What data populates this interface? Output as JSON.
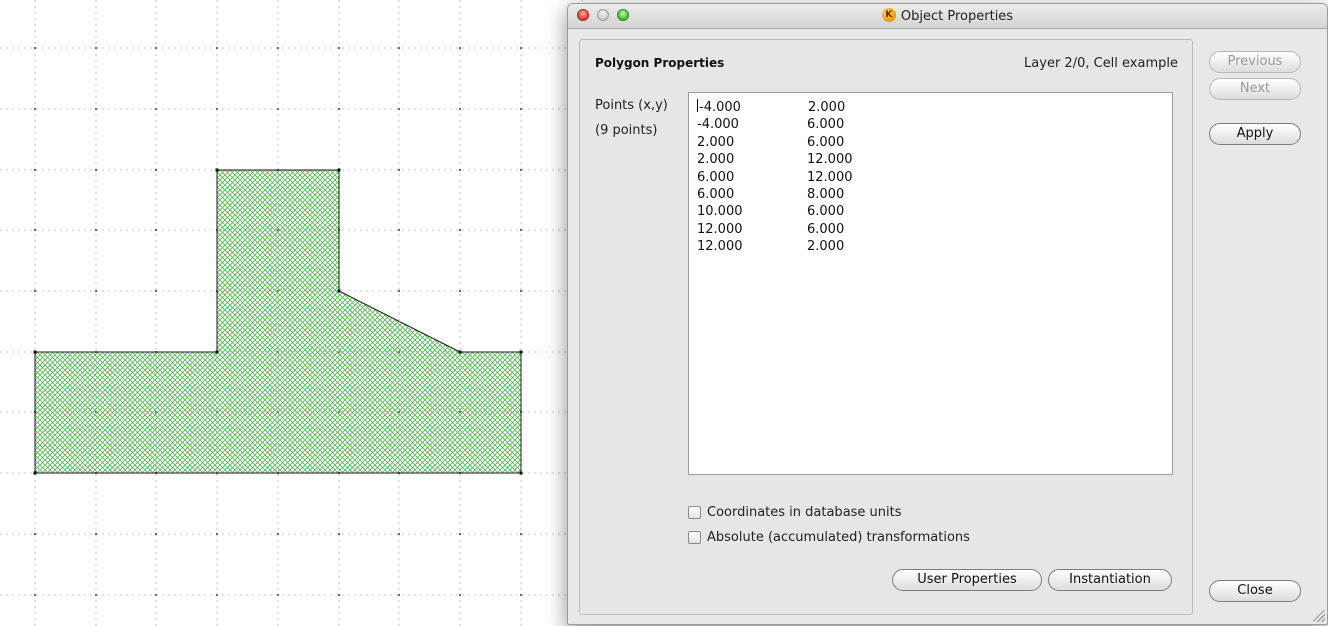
{
  "window": {
    "title": "Object Properties",
    "app_icon_letter": "K"
  },
  "panel": {
    "section_title": "Polygon Properties",
    "layer_info": "Layer 2/0, Cell example",
    "points_label": "Points (x,y)",
    "points_count": "(9 points)",
    "points": [
      {
        "x": "-4.000",
        "y": "2.000"
      },
      {
        "x": "-4.000",
        "y": "6.000"
      },
      {
        "x": "2.000",
        "y": "6.000"
      },
      {
        "x": "2.000",
        "y": "12.000"
      },
      {
        "x": "6.000",
        "y": "12.000"
      },
      {
        "x": "6.000",
        "y": "8.000"
      },
      {
        "x": "10.000",
        "y": "6.000"
      },
      {
        "x": "12.000",
        "y": "6.000"
      },
      {
        "x": "12.000",
        "y": "2.000"
      }
    ],
    "checkbox_db_units": {
      "label": "Coordinates in database units",
      "checked": false
    },
    "checkbox_absolute": {
      "label": "Absolute (accumulated) transformations",
      "checked": false
    },
    "user_properties_label": "User Properties",
    "instantiation_label": "Instantiation"
  },
  "side_buttons": {
    "previous_label": "Previous",
    "next_label": "Next",
    "apply_label": "Apply",
    "close_label": "Close"
  },
  "canvas": {
    "polygon_fill": "#5ab65a",
    "grid_color": "#b4b4b4"
  }
}
